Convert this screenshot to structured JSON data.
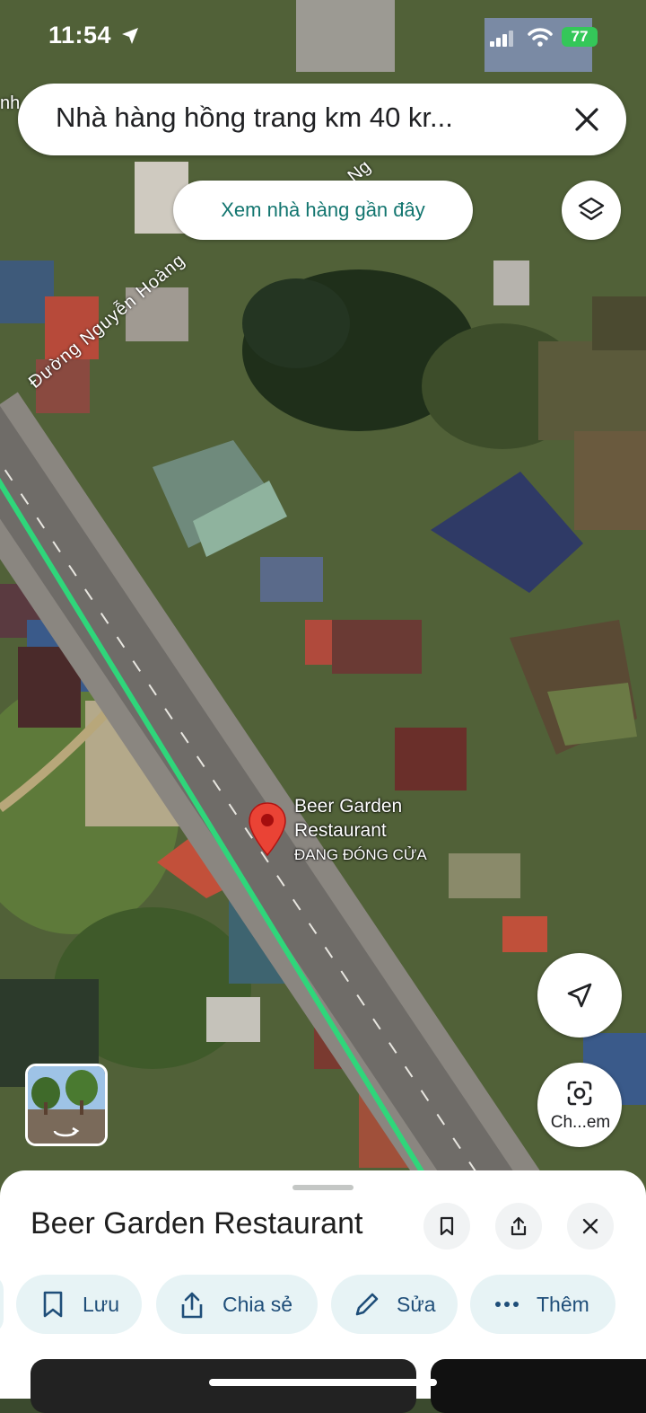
{
  "status_bar": {
    "time": "11:54",
    "battery": "77"
  },
  "search": {
    "query": "Nhà hàng hồng trang km 40 kr..."
  },
  "nearby_chip": {
    "label": "Xem nhà hàng gần đây"
  },
  "map_labels": {
    "road_main": "Đường Nguyễn Hoàng",
    "road_top": "Ng",
    "edge_left": "nh"
  },
  "place_pin": {
    "name_line1": "Beer Garden",
    "name_line2": "Restaurant",
    "status": "ĐANG ĐÓNG CỬA"
  },
  "camera_button": {
    "label": "Ch...em"
  },
  "sheet": {
    "title": "Beer Garden Restaurant",
    "actions": [
      {
        "label": "Lưu",
        "icon": "bookmark-icon"
      },
      {
        "label": "Chia sẻ",
        "icon": "share-icon"
      },
      {
        "label": "Sửa",
        "icon": "pencil-icon"
      },
      {
        "label": "Thêm",
        "icon": "more-horizontal-icon"
      }
    ]
  },
  "colors": {
    "accent": "#12756f",
    "route": "#2fd67a",
    "pin": "#ea4335",
    "pill_bg": "#e7f3f5"
  }
}
